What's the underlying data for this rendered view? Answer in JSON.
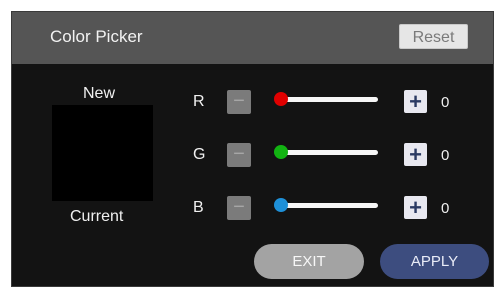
{
  "window": {
    "title": "Color Picker"
  },
  "toolbar": {
    "reset_label": "Reset"
  },
  "preview": {
    "new_label": "New",
    "current_label": "Current",
    "color": "#000000"
  },
  "channels": [
    {
      "label": "R",
      "minus": "−",
      "plus": "+",
      "value": "0",
      "thumb_color": "#e00000",
      "level": 0
    },
    {
      "label": "G",
      "minus": "−",
      "plus": "+",
      "value": "0",
      "thumb_color": "#12b312",
      "level": 0
    },
    {
      "label": "B",
      "minus": "−",
      "plus": "+",
      "value": "0",
      "thumb_color": "#1e90d8",
      "level": 0
    }
  ],
  "actions": {
    "exit_label": "EXIT",
    "apply_label": "APPLY"
  },
  "colors": {
    "accent": "#3d4d7f",
    "background": "#131313",
    "titlebar": "#555555"
  }
}
